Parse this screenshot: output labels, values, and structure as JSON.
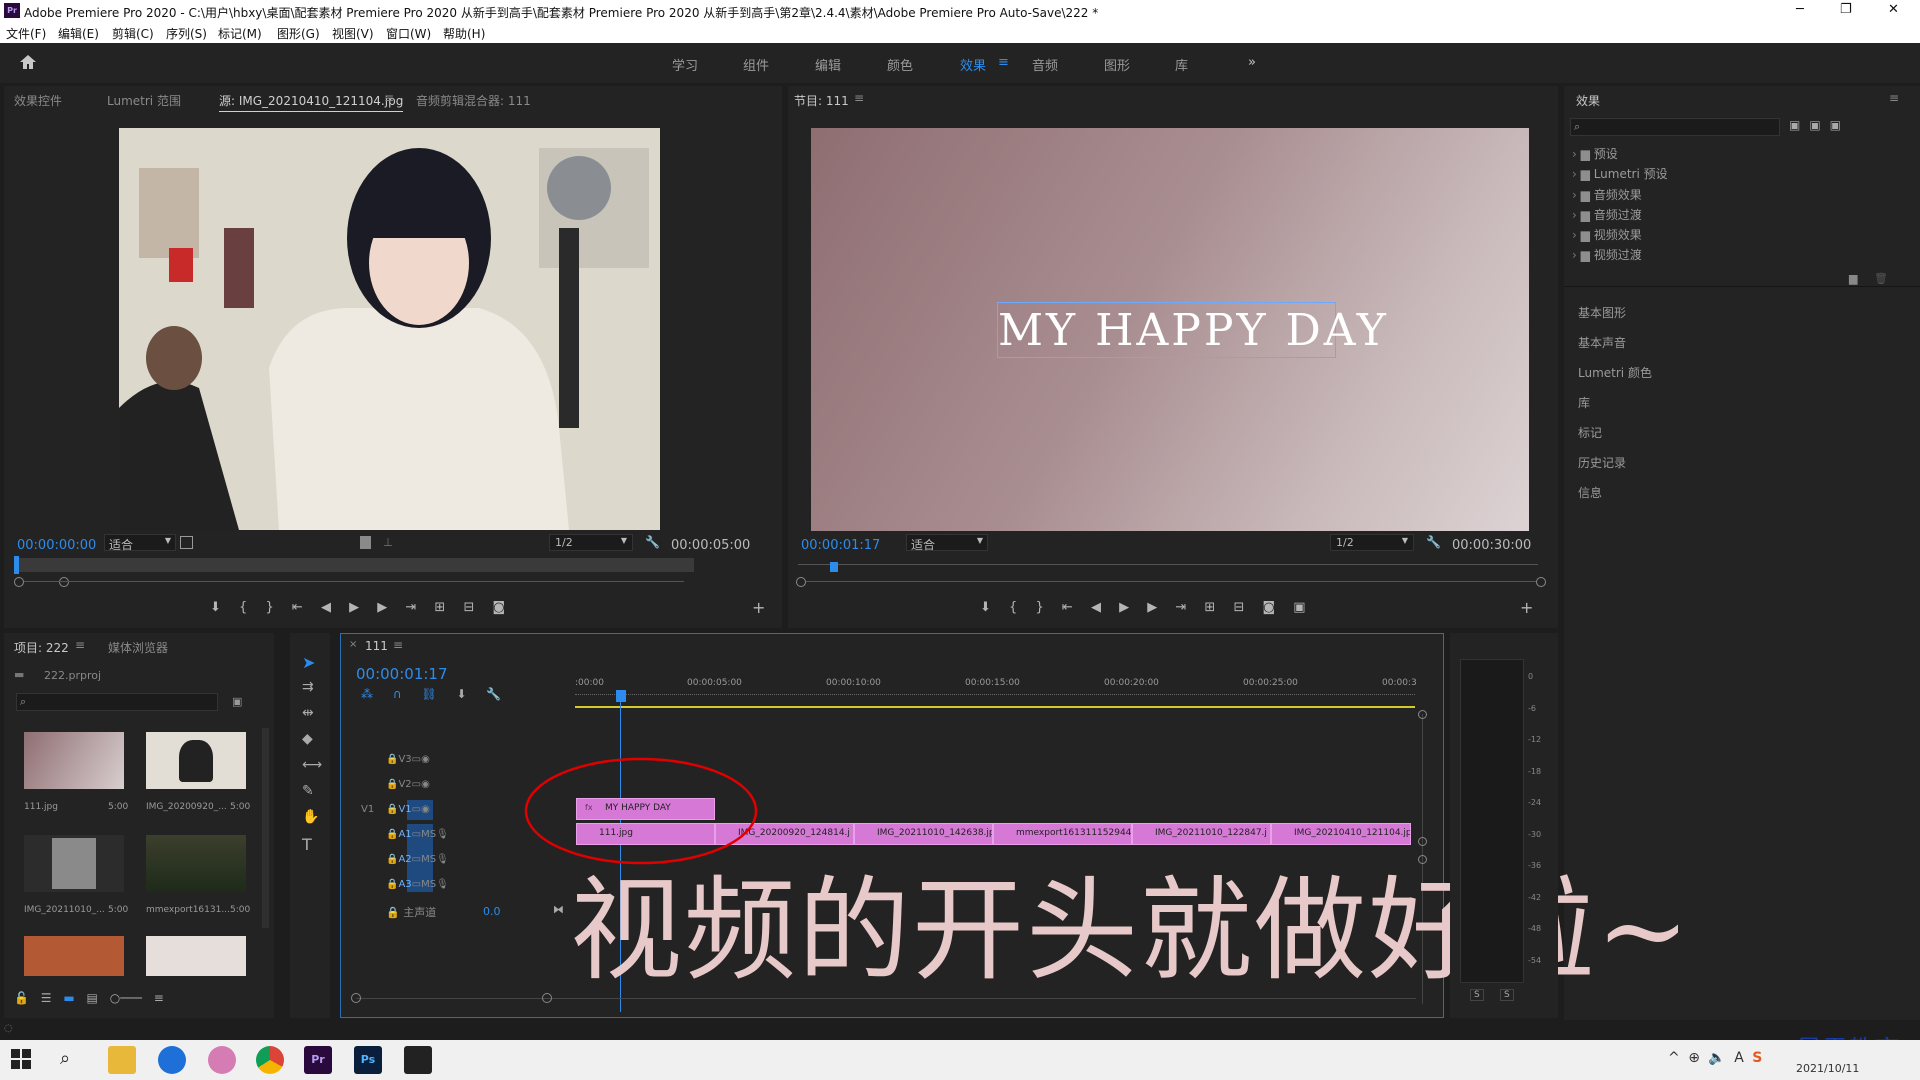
{
  "window": {
    "title": "Adobe Premiere Pro 2020 - C:\\用户\\hbxy\\桌面\\配套素材 Premiere Pro 2020 从新手到高手\\配套素材 Premiere Pro 2020 从新手到高手\\第2章\\2.4.4\\素材\\Adobe Premiere Pro Auto-Save\\222 *",
    "minimize": "─",
    "maximize": "❐",
    "close": "✕"
  },
  "menu": [
    "文件(F)",
    "编辑(E)",
    "剪辑(C)",
    "序列(S)",
    "标记(M)",
    "图形(G)",
    "视图(V)",
    "窗口(W)",
    "帮助(H)"
  ],
  "workspaces": [
    "学习",
    "组件",
    "编辑",
    "颜色",
    "效果",
    "音频",
    "图形",
    "库"
  ],
  "workspace_active": "效果",
  "workspace_more": "»",
  "source_tabs": [
    "效果控件",
    "Lumetri 范围",
    "源: IMG_20210410_121104.jpg",
    "音频剪辑混合器: 111"
  ],
  "source": {
    "timecode": "00:00:00:00",
    "fit": "适合",
    "fraction": "1/2",
    "duration": "00:00:05:00"
  },
  "program": {
    "tab": "节目: 111",
    "timecode": "00:00:01:17",
    "fit": "适合",
    "fraction": "1/2",
    "duration": "00:00:30:00",
    "title_text": "MY HAPPY DAY"
  },
  "effects": {
    "tab": "效果",
    "folders": [
      "预设",
      "Lumetri 预设",
      "音频效果",
      "音频过渡",
      "视频效果",
      "视频过渡"
    ],
    "panels": [
      "基本图形",
      "基本声音",
      "Lumetri 颜色",
      "库",
      "标记",
      "历史记录",
      "信息"
    ]
  },
  "project": {
    "tab": "项目: 222",
    "tab2": "媒体浏览器",
    "file": "222.prproj",
    "items": [
      {
        "name": "111.jpg",
        "dur": "5:00",
        "color": "#b08a8e"
      },
      {
        "name": "IMG_20200920_...",
        "dur": "5:00",
        "color": "#d8d8d8"
      },
      {
        "name": "IMG_20211010_...",
        "dur": "5:00",
        "color": "#777"
      },
      {
        "name": "mmexport16131...",
        "dur": "5:00",
        "color": "#3c3f2c"
      }
    ]
  },
  "timeline": {
    "tab": "111",
    "timecode": "00:00:01:17",
    "ruler": [
      ":00:00",
      "00:00:05:00",
      "00:00:10:00",
      "00:00:15:00",
      "00:00:20:00",
      "00:00:25:00",
      "00:00:3"
    ],
    "tracks": [
      {
        "name": "V3",
        "src": ""
      },
      {
        "name": "V2",
        "src": ""
      },
      {
        "name": "V1",
        "src": "V1"
      },
      {
        "name": "A1",
        "src": ""
      },
      {
        "name": "A2",
        "src": ""
      },
      {
        "name": "A3",
        "src": ""
      }
    ],
    "master": "主声道",
    "master_val": "0.0",
    "v2_clip": "MY HAPPY DAY",
    "v1_clips": [
      "111.jpg",
      "IMG_20200920_124814.j",
      "IMG_20211010_142638.jp",
      "mmexport1613111529447",
      "IMG_20211010_122847.j",
      "IMG_20210410_121104.jp"
    ]
  },
  "meter": {
    "scale": [
      "0",
      "-6",
      "-12",
      "-18",
      "-24",
      "-30",
      "-36",
      "-42",
      "-48",
      "-54"
    ],
    "solo": "S"
  },
  "overlay_caption": "视频的开头就做好啦~",
  "watermark": "最需教育",
  "taskbar": {
    "date": "2021/10/11",
    "ime": "S"
  },
  "colors": {
    "accent": "#2d8ceb",
    "clip": "#d679d6",
    "annotation": "#e00000"
  }
}
